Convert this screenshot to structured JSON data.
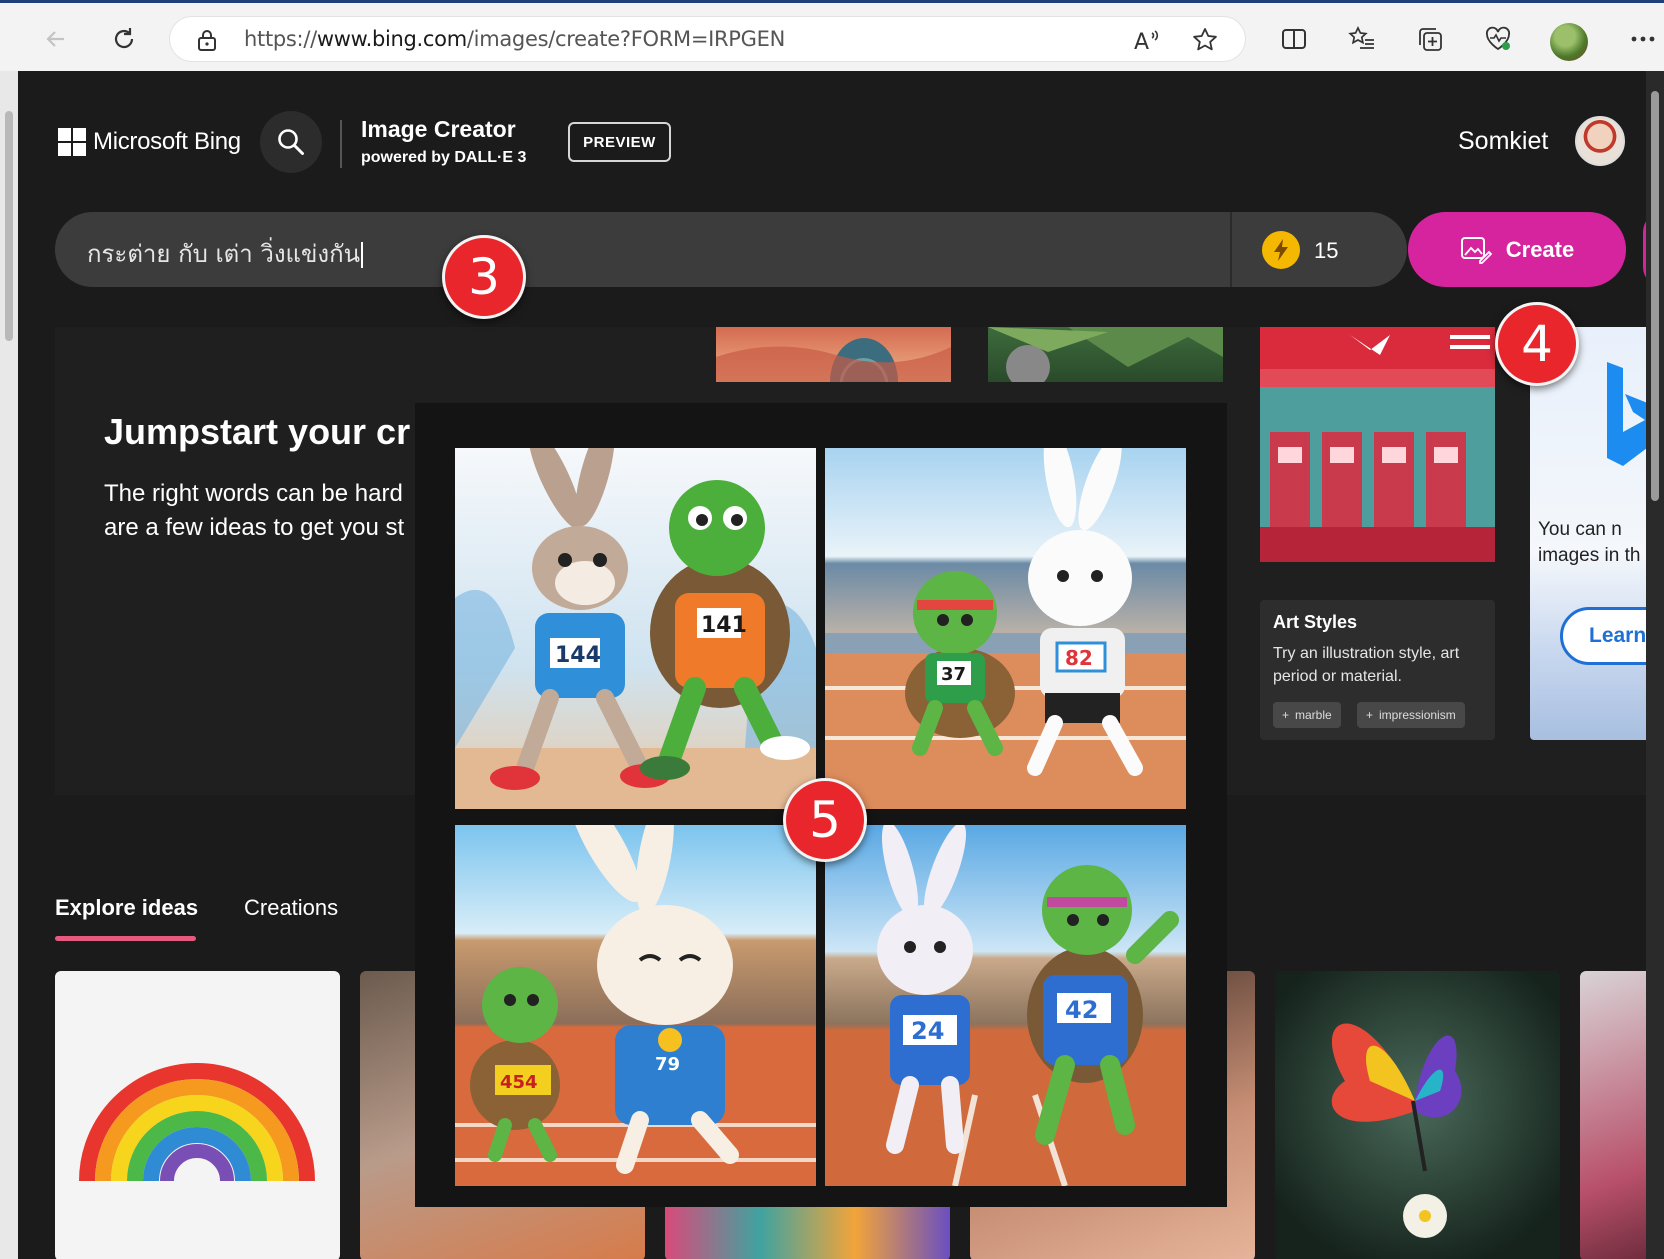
{
  "browser": {
    "url_prefix": "https://",
    "url_host": "www.bing.com",
    "url_path": "/images/create?FORM=IRPGEN",
    "icons": [
      "back-icon",
      "refresh-icon",
      "lock-icon",
      "read-aloud-icon",
      "favorite-star-icon",
      "split-screen-icon",
      "favorites-icon",
      "collections-icon",
      "browser-essentials-icon",
      "profile-icon",
      "more-icon"
    ]
  },
  "header": {
    "brand": "Microsoft Bing",
    "app_title": "Image Creator",
    "app_subtitle": "powered by DALL·E 3",
    "badge": "PREVIEW",
    "user_name": "Somkiet"
  },
  "prompt": {
    "value": "กระต่าย กับ เต่า วิ่งแข่งกัน",
    "boosts": "15",
    "create_label": "Create"
  },
  "hero": {
    "title": "Jumpstart your cr",
    "desc_line1": "The right words can be hard",
    "desc_line2": "are a few ideas to get you st"
  },
  "art_styles": {
    "title": "Art Styles",
    "desc": "Try an illustration style, art period or material.",
    "chips": [
      "marble",
      "impressionism"
    ]
  },
  "promo": {
    "text_line1": "You can n",
    "text_line2": "images in th",
    "learn_label": "Learn"
  },
  "tabs": {
    "explore": "Explore ideas",
    "creations": "Creations"
  },
  "results": {
    "images": [
      {
        "bib_rabbit": "144",
        "bib_turtle": "141"
      },
      {
        "bib_rabbit": "82",
        "bib_turtle": "37"
      },
      {
        "bib_rabbit": "79",
        "bib_turtle": "454"
      },
      {
        "bib_rabbit": "24",
        "bib_turtle": "42"
      }
    ]
  },
  "callouts": [
    "3",
    "4",
    "5"
  ],
  "colors": {
    "accent": "#d6249f",
    "callout": "#e8262b",
    "background": "#1b1b1b"
  }
}
